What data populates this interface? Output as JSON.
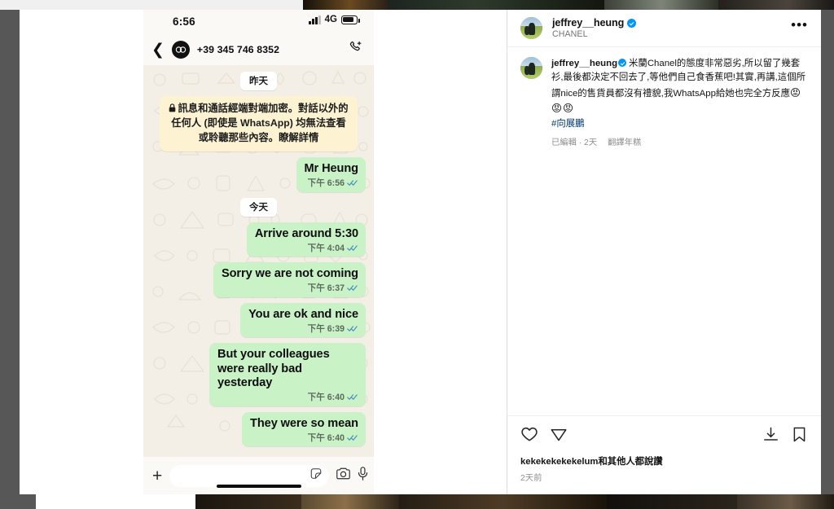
{
  "frame": {
    "background_color": "#575757",
    "card_background": "#ffffff"
  },
  "whatsapp": {
    "status_bar": {
      "time": "6:56",
      "network": "4G",
      "signal_icon": "signal-bars-icon",
      "battery_icon": "battery-icon"
    },
    "header": {
      "back_icon": "back-chevron-icon",
      "avatar_icon": "chanel-logo-avatar",
      "contact_name": "+39 345 746 8352",
      "call_icon": "add-call-icon"
    },
    "background_color": "#f3efe7",
    "bubble_color": "#c9f2c7",
    "notice_color": "#fdf3d3",
    "thread": [
      {
        "kind": "day",
        "label": "昨天"
      },
      {
        "kind": "notice",
        "lock_icon": "lock-icon",
        "text": "訊息和通話經端對端加密。對話以外的任何人 (即使是 WhatsApp) 均無法查看或聆聽那些內容。瞭解詳情"
      },
      {
        "kind": "message",
        "text": "Mr Heung",
        "time": "下午 6:56",
        "status_icon": "double-check-icon"
      },
      {
        "kind": "day",
        "label": "今天"
      },
      {
        "kind": "message",
        "text": "Arrive around 5:30",
        "time": "下午 4:04",
        "status_icon": "double-check-icon"
      },
      {
        "kind": "message",
        "text": "Sorry we are not coming",
        "time": "下午 6:37",
        "status_icon": "double-check-icon"
      },
      {
        "kind": "message",
        "text": "You are ok and nice",
        "time": "下午 6:39",
        "status_icon": "double-check-icon"
      },
      {
        "kind": "message",
        "text": "But your colleagues were really bad yesterday",
        "time": "下午 6:40",
        "status_icon": "double-check-icon"
      },
      {
        "kind": "message",
        "text": "They were so mean",
        "time": "下午 6:40",
        "status_icon": "double-check-icon"
      }
    ],
    "composer": {
      "plus_icon": "plus-icon",
      "input_value": "",
      "input_placeholder": "",
      "sticker_icon": "sticker-icon",
      "camera_icon": "camera-icon",
      "mic_icon": "microphone-icon"
    }
  },
  "instagram": {
    "header": {
      "avatar_icon": "profile-avatar",
      "username": "jeffrey__heung",
      "verified_icon": "verified-badge-icon",
      "sublabel": "CHANEL",
      "more_icon": "more-options-icon"
    },
    "caption": {
      "avatar_icon": "profile-avatar",
      "username": "jeffrey__heung",
      "verified_icon": "verified-badge-icon",
      "text": "米蘭Chanel的態度非常惡劣,所以留了幾套衫,最後都決定不回去了,等他們自己食香蕉吧!其實,再講,這個所謂nice的售貨員都沒有禮貌,我WhatsApp給她也完全方反應",
      "emoji": "😡😡😡",
      "hashtag": "#向展鵬",
      "edited_label": "已編輯 · 2天",
      "translate_label": "翻譯年糕"
    },
    "actions": {
      "like_icon": "heart-icon",
      "share_icon": "share-paper-plane-icon",
      "download_icon": "download-icon",
      "save_icon": "bookmark-icon"
    },
    "footer": {
      "likes_text": "kekekekekekelum和其他人都說讚",
      "post_age": "2天前"
    }
  }
}
